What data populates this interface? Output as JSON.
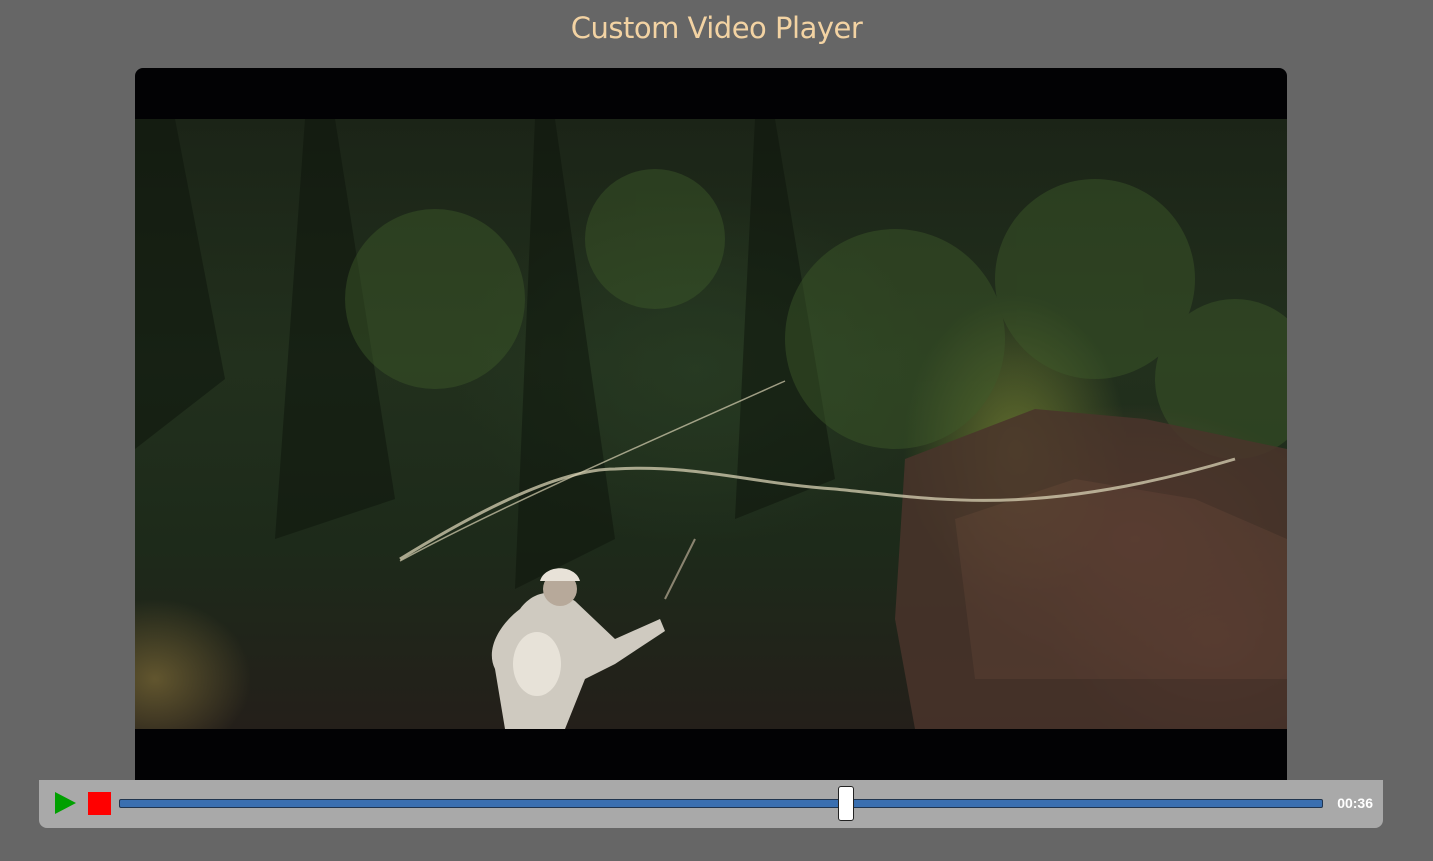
{
  "page": {
    "title": "Custom Video Player"
  },
  "player": {
    "video_state": "playing",
    "progress_fraction": 0.604,
    "time_display": "00:36",
    "icons": {
      "play": "play-icon",
      "stop": "stop-icon"
    }
  },
  "colors": {
    "background": "#666666",
    "title": "#f3d3a3",
    "controls_bar": "#a9a9a9",
    "play": "#00a000",
    "stop": "#ff0000",
    "progress_track": "#3a6fb0"
  }
}
